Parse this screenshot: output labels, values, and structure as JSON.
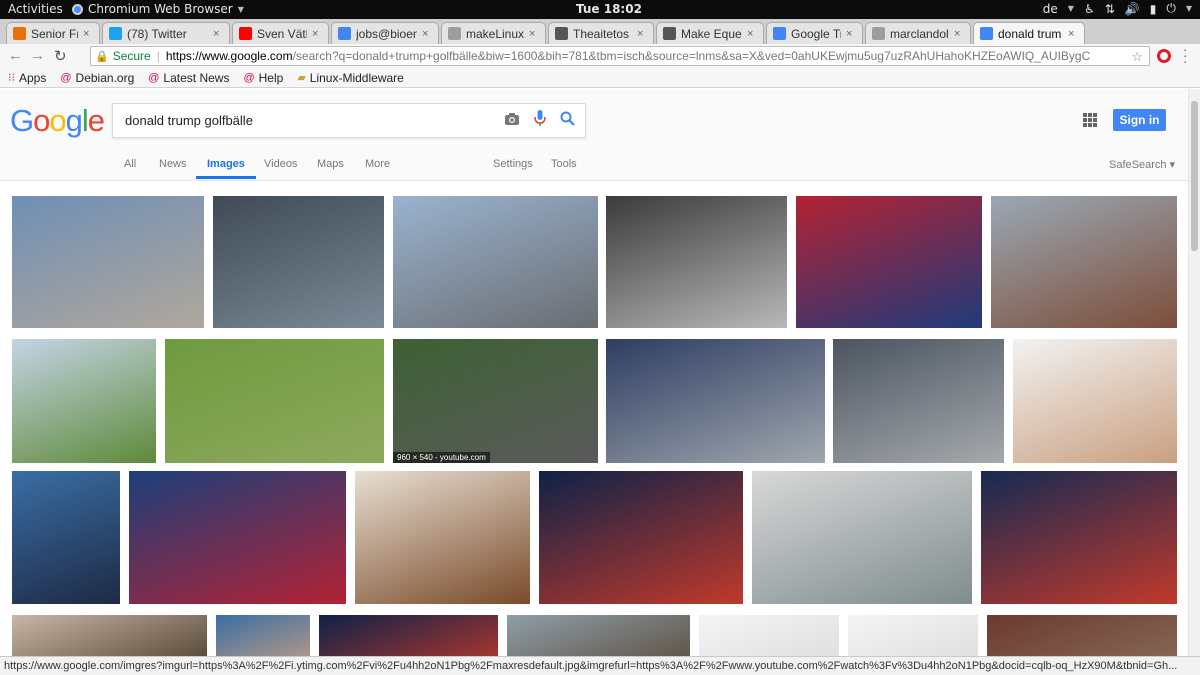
{
  "system_bar": {
    "activities": "Activities",
    "app_name": "Chromium Web Browser",
    "clock": "Tue 18:02",
    "keyboard_layout": "de"
  },
  "tabs": [
    {
      "label": "Senior Front",
      "favicon": "orange-square-icon",
      "color": "#e8710a"
    },
    {
      "label": "(78) Twitter",
      "favicon": "twitter-bird-icon",
      "color": "#1da1f2"
    },
    {
      "label": "Sven Väth",
      "favicon": "youtube-icon",
      "color": "#ff0000"
    },
    {
      "label": "jobs@bioen",
      "favicon": "google-g-icon",
      "color": "#4285f4"
    },
    {
      "label": "makeLinuxG",
      "favicon": "document-icon",
      "color": "#9e9e9e"
    },
    {
      "label": "Theaitetos",
      "favicon": "wikipedia-icon",
      "color": "#555555"
    },
    {
      "label": "Make Equest",
      "favicon": "wikipedia-icon",
      "color": "#555555"
    },
    {
      "label": "Google Tran",
      "favicon": "google-translate-icon",
      "color": "#4285f4"
    },
    {
      "label": "marclandolt",
      "favicon": "document-icon",
      "color": "#9e9e9e"
    },
    {
      "label": "donald trum",
      "favicon": "google-g-icon",
      "color": "#4285f4"
    }
  ],
  "omnibox": {
    "secure_label": "Secure",
    "host": "https://www.google.com",
    "path": "/search?q=donald+trump+golfbälle&biw=1600&bih=781&tbm=isch&source=lnms&sa=X&ved=0ahUKEwjmu5ug7uzRAhUHahoKHZEoAWIQ_AUIBygC"
  },
  "bookmarks": [
    {
      "label": "Apps",
      "icon": "apps-grid-icon"
    },
    {
      "label": "Debian.org",
      "icon": "debian-swirl-icon"
    },
    {
      "label": "Latest News",
      "icon": "debian-swirl-icon"
    },
    {
      "label": "Help",
      "icon": "debian-swirl-icon"
    },
    {
      "label": "Linux-Middleware",
      "icon": "folder-icon"
    }
  ],
  "google": {
    "logo": [
      "G",
      "o",
      "o",
      "g",
      "l",
      "e"
    ],
    "query": "donald trump golfbälle",
    "sign_in": "Sign in",
    "tabs": [
      "All",
      "News",
      "Images",
      "Videos",
      "Maps",
      "More"
    ],
    "active_tab": "Images",
    "settings": "Settings",
    "tools": "Tools",
    "safesearch": "SafeSearch",
    "overlay_caption": "960 × 540 - youtube.com"
  },
  "thumbnails": [
    {
      "name": "thumb-man-holding-red-balls-1",
      "colors": [
        "#6f8fb5",
        "#b0a79c"
      ]
    },
    {
      "name": "thumb-crowd-suits-1",
      "colors": [
        "#3f4a56",
        "#7a8a96"
      ]
    },
    {
      "name": "thumb-man-holding-red-balls-2",
      "colors": [
        "#9ab3cf",
        "#6a6d72"
      ]
    },
    {
      "name": "thumb-man-holding-red-balls-3",
      "colors": [
        "#3b3b3b",
        "#b8b8b8"
      ]
    },
    {
      "name": "thumb-trump-rally-trump-sign",
      "colors": [
        "#b22234",
        "#1f3b7a"
      ]
    },
    {
      "name": "thumb-golf-course-crowd",
      "colors": [
        "#9aa8b4",
        "#7d4e3a"
      ]
    },
    {
      "name": "thumb-golf-course-group",
      "colors": [
        "#c4d4e4",
        "#5e8a3a"
      ]
    },
    {
      "name": "thumb-red-balls-on-grass",
      "colors": [
        "#6f9a3e",
        "#8ea95d"
      ]
    },
    {
      "name": "thumb-man-with-red-balls-youtube",
      "colors": [
        "#3d6134",
        "#5a5a5a"
      ]
    },
    {
      "name": "thumb-man-holding-red-balls-4",
      "colors": [
        "#2e3d63",
        "#9fa6ad"
      ]
    },
    {
      "name": "thumb-crowd-with-balls",
      "colors": [
        "#4b5560",
        "#a5a9ad"
      ]
    },
    {
      "name": "thumb-trump-white-cap",
      "colors": [
        "#f2f2f2",
        "#c9a080"
      ]
    },
    {
      "name": "thumb-trump-podium",
      "colors": [
        "#3a6ea5",
        "#1e2a44"
      ]
    },
    {
      "name": "thumb-trump-rally-flags",
      "colors": [
        "#1c3f7a",
        "#b22234"
      ]
    },
    {
      "name": "thumb-trump-and-son",
      "colors": [
        "#e8dfd2",
        "#7a4b2a"
      ]
    },
    {
      "name": "thumb-debate-stage-1",
      "colors": [
        "#0d2247",
        "#c0392b"
      ]
    },
    {
      "name": "thumb-collage-balls-cap",
      "colors": [
        "#d8d8d8",
        "#7f8c8d"
      ]
    },
    {
      "name": "thumb-debate-stage-2",
      "colors": [
        "#152a52",
        "#c0392b"
      ]
    },
    {
      "name": "thumb-row4-1",
      "colors": [
        "#c8b8a8",
        "#4a3a2a"
      ]
    },
    {
      "name": "thumb-row4-2",
      "colors": [
        "#3a6ea5",
        "#c9a080"
      ]
    },
    {
      "name": "thumb-row4-3",
      "colors": [
        "#0d2247",
        "#c0392b"
      ]
    },
    {
      "name": "thumb-row4-4",
      "colors": [
        "#8e9ea8",
        "#5a4a3a"
      ]
    },
    {
      "name": "thumb-row4-5",
      "colors": [
        "#f4f4f4",
        "#dcdcdc"
      ]
    },
    {
      "name": "thumb-row4-6",
      "colors": [
        "#f4f4f4",
        "#dcdcdc"
      ]
    },
    {
      "name": "thumb-row4-7",
      "colors": [
        "#6b3a30",
        "#8a6d5a"
      ]
    }
  ],
  "status_url": "https://www.google.com/imgres?imgurl=https%3A%2F%2Fi.ytimg.com%2Fvi%2Fu4hh2oN1Pbg%2Fmaxresdefault.jpg&imgrefurl=https%3A%2F%2Fwww.youtube.com%2Fwatch%3Fv%3Du4hh2oN1Pbg&docid=cqlb-oq_HzX90M&tbnid=Gh..."
}
